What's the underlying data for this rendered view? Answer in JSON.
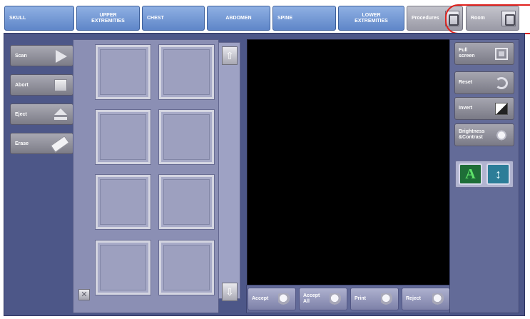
{
  "tabs": [
    {
      "label": "SKULL",
      "centered": false
    },
    {
      "label": "UPPER\nEXTREMITIES",
      "centered": true
    },
    {
      "label": "CHEST",
      "centered": false
    },
    {
      "label": "ABDOMEN",
      "centered": true
    },
    {
      "label": "SPINE",
      "centered": false
    },
    {
      "label": "LOWER\nEXTREMITIES",
      "centered": true
    }
  ],
  "header": {
    "procedures_label": "Procedures",
    "room_label": "Room"
  },
  "side_buttons": {
    "scan": "Scan",
    "abort": "Abort",
    "eject": "Eject",
    "erase": "Erase"
  },
  "thumbnails": {
    "count": 8,
    "scroll_up_glyph": "⇧",
    "scroll_down_glyph": "⇩",
    "close_glyph": "✕"
  },
  "viewer_actions": {
    "accept": "Accept",
    "accept_all": "Accept\nAll",
    "print": "Print",
    "reject": "Reject"
  },
  "tools": {
    "full_screen": "Full\nscreen",
    "reset": "Reset",
    "invert": "Invert",
    "brightness_contrast": "Brightness\n&Contrast"
  },
  "colors": {
    "tab_blue": "#6f93d0",
    "frame": "#4d5788",
    "viewer": "#000000",
    "annotation": "#e0221e"
  }
}
